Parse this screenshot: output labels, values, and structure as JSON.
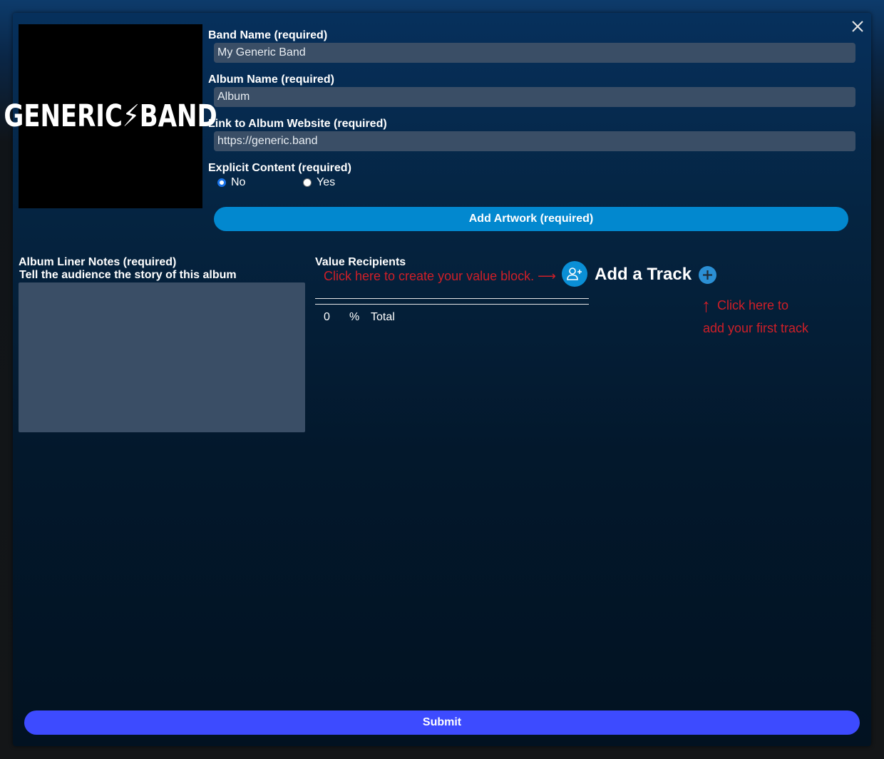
{
  "artwork": {
    "logo_text": "GENERIC⚡BAND"
  },
  "form": {
    "band_name": {
      "label": "Band Name (required)",
      "value": "My Generic Band"
    },
    "album_name": {
      "label": "Album Name (required)",
      "value": "Album"
    },
    "album_link": {
      "label": "Link to Album Website (required)",
      "value": "https://generic.band"
    },
    "explicit": {
      "label": "Explicit Content (required)",
      "options": [
        {
          "label": "No",
          "checked": true
        },
        {
          "label": "Yes",
          "checked": false
        }
      ]
    },
    "add_artwork_label": "Add Artwork (required)"
  },
  "liner_notes": {
    "label": "Album Liner Notes (required)",
    "sublabel": "Tell the audience the story of this album",
    "value": ""
  },
  "value_recipients": {
    "label": "Value Recipients",
    "hint": "Click here to create your value block. ⟶",
    "total_value": "0",
    "total_unit": "%",
    "total_label": "Total"
  },
  "tracks": {
    "add_label": "Add a Track",
    "hint_line1": "Click here to",
    "hint_arrow": "↑",
    "hint_line2": "add your first track"
  },
  "submit_label": "Submit",
  "colors": {
    "accent_blue": "#0288cf",
    "submit_blue": "#3d4bff",
    "hint_red": "#d01f28",
    "field_bg": "#3a4e66"
  }
}
